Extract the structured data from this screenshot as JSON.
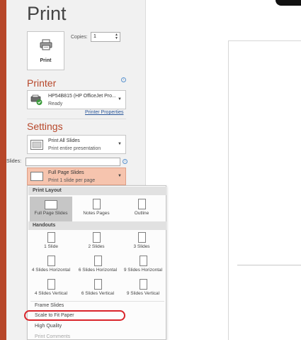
{
  "title": "Print",
  "print_button_label": "Print",
  "copies": {
    "label": "Copies:",
    "value": "1"
  },
  "printer": {
    "heading": "Printer",
    "name": "HP54B815 (HP OfficeJet Pro...",
    "status": "Ready",
    "properties_link": "Printer Properties"
  },
  "settings": {
    "heading": "Settings",
    "print_range": {
      "title": "Print All Slides",
      "subtitle": "Print entire presentation"
    },
    "slides_label": "Slides:",
    "slides_value": "",
    "layout": {
      "title": "Full Page Slides",
      "subtitle": "Print 1 slide per page"
    }
  },
  "menu": {
    "print_layout_header": "Print Layout",
    "print_layout": [
      "Full Page Slides",
      "Notes Pages",
      "Outline"
    ],
    "handouts_header": "Handouts",
    "handouts_row1": [
      "1 Slide",
      "2 Slides",
      "3 Slides"
    ],
    "handouts_row2": [
      "4 Slides Horizontal",
      "6 Slides Horizontal",
      "9 Slides Horizontal"
    ],
    "handouts_row3": [
      "4 Slides Vertical",
      "6 Slides Vertical",
      "9 Slides Vertical"
    ],
    "options": [
      "Frame Slides",
      "Scale to Fit Paper",
      "High Quality",
      "Print Comments"
    ]
  },
  "colors": {
    "accent": "#b7472a",
    "highlight": "#d9252b",
    "link": "#2b579a"
  },
  "icons": [
    "printer-icon",
    "info-icon",
    "printer-status-icon",
    "slides-icon",
    "page-icon",
    "spin-arrows-icon",
    "chevron-down-icon"
  ]
}
